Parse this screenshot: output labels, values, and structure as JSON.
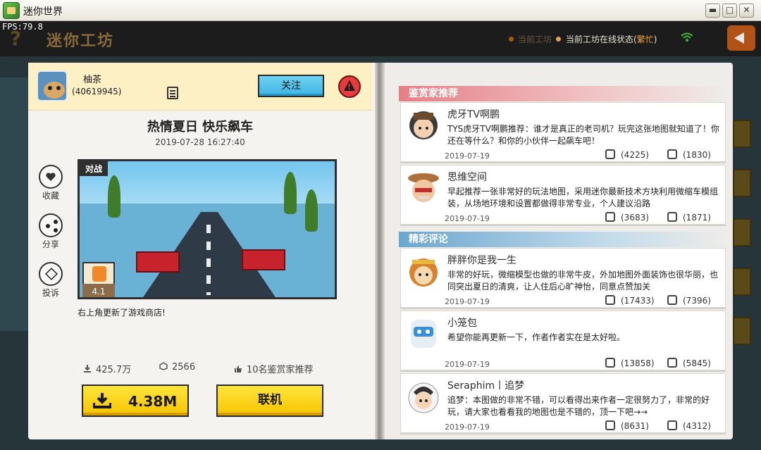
{
  "window": {
    "title": "迷你世界",
    "fps": "FPS:79.8",
    "buttons": {
      "minimize": "▬",
      "maximize": "□",
      "close": "✕"
    }
  },
  "background": {
    "help": "?",
    "title": "迷你工坊",
    "status_left": "当前工坊",
    "status_label": "当前工坊在线状态(",
    "status_busy": "繁忙",
    "status_close": ")"
  },
  "author": {
    "name": "柚茶",
    "id": "(40619945)",
    "follow_label": "关注"
  },
  "map": {
    "title": "热情夏日 快乐飙车",
    "date": "2019-07-28    16:27:40",
    "tag": "对战",
    "rating": "4.1",
    "description": "右上角更新了游戏商店!",
    "downloads": "425.7万",
    "plays": "2566",
    "recommend": "10名鉴赏家推荐",
    "download_size": "4.38M",
    "online_label": "联机"
  },
  "side_actions": {
    "collect": "收藏",
    "share": "分享",
    "report": "投诉"
  },
  "sections": {
    "experts": "鉴赏家推荐",
    "comments": "精彩评论"
  },
  "expert_comments": [
    {
      "name": "虎牙TV啊鹏",
      "text": "TYS虎牙TV啊鹏推荐：谁才是真正的老司机？玩完这张地图就知道了！你还在等什么？和你的小伙伴一起飙车吧！",
      "date": "2019-07-19",
      "likes": "(4225)",
      "dislikes": "(1830)"
    },
    {
      "name": "思维空间",
      "text": "早起推荐一张非常好的玩法地图，采用迷你最新技术方块利用微缩车模组装，从场地环境和设置都做得非常专业，个人建议沿路",
      "date": "2019-07-19",
      "likes": "(3683)",
      "dislikes": "(1871)"
    }
  ],
  "comments": [
    {
      "name": "胖胖你是我一生",
      "text": "非常的好玩，微缩模型也做的非常牛皮，外加地图外面装饰也很华丽，也同突出夏日的清爽，让人住后心旷神怡，同意点赞加关",
      "date": "2019-07-19",
      "likes": "(17433)",
      "dislikes": "(7396)"
    },
    {
      "name": "小笼包",
      "text": "希望你能再更新一下，作者作者实在是太好啦。",
      "date": "2019-07-19",
      "likes": "(13858)",
      "dislikes": "(5845)"
    },
    {
      "name": "Seraphim丨追梦",
      "text": "追梦：本图做的非常不错，可以看得出来作者一定很努力了，非常的好玩，请大家也看看我的地图也是不错的，顶一下吧→→",
      "date": "2019-07-19",
      "likes": "(8631)",
      "dislikes": "(4312)"
    }
  ],
  "colors": {
    "accent_yellow": "#f5c400",
    "follow_blue": "#3eb4e3",
    "expert_header": "#e47f86",
    "comment_header": "#6aa7cf",
    "busy": "#f0a33a"
  }
}
